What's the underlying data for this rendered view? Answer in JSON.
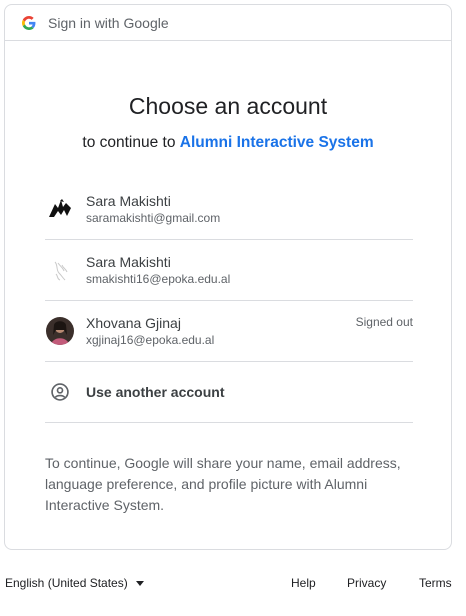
{
  "header": {
    "text": "Sign in with Google",
    "logo_icon": "google-g-icon"
  },
  "title": "Choose an account",
  "subtitle": {
    "prefix": "to continue to",
    "app_name": "Alumni Interactive System"
  },
  "accounts": [
    {
      "name": "Sara Makishti",
      "email": "saramakishti@gmail.com",
      "status": "",
      "avatar_icon": "silhouette-avatar"
    },
    {
      "name": "Sara Makishti",
      "email": "smakishti16@epoka.edu.al",
      "status": "",
      "avatar_icon": "sketch-avatar"
    },
    {
      "name": "Xhovana Gjinaj",
      "email": "xgjinaj16@epoka.edu.al",
      "status": "Signed out",
      "avatar_icon": "photo-avatar"
    }
  ],
  "use_another": {
    "label": "Use another account",
    "icon": "account-circle-icon"
  },
  "notice": "To continue, Google will share your name, email address, language preference, and profile picture with Alumni Interactive System.",
  "footer": {
    "language": "English (United States)",
    "help": "Help",
    "privacy": "Privacy",
    "terms": "Terms"
  },
  "colors": {
    "accent": "#1a73e8",
    "border": "#dadce0",
    "muted": "#5f6368"
  }
}
